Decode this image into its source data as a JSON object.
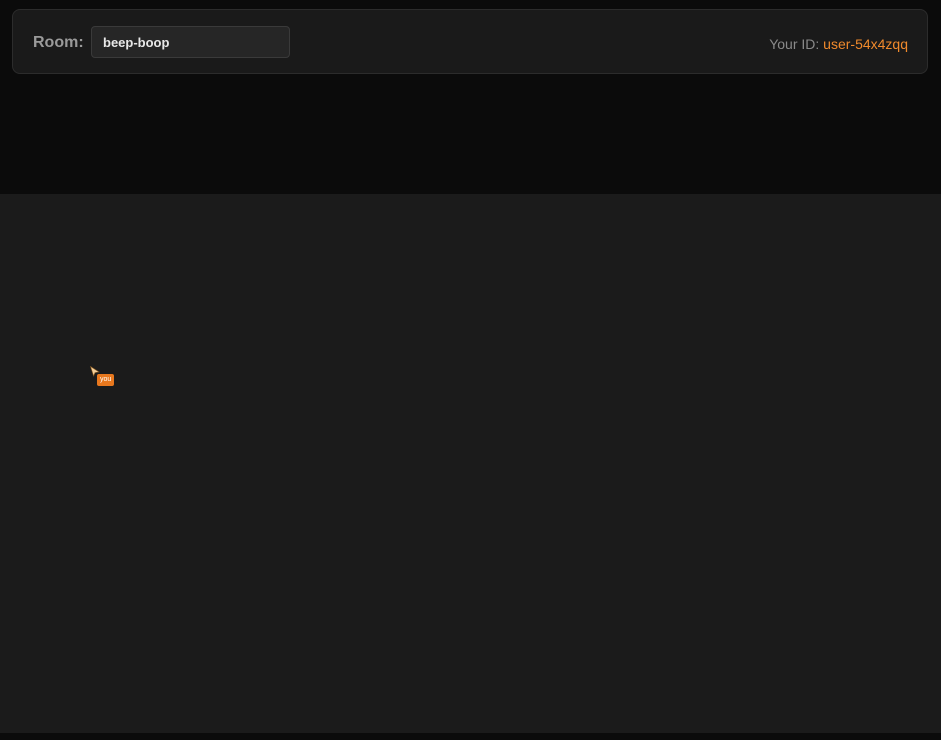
{
  "header": {
    "room_label": "Room:",
    "room_value": "beep-boop",
    "user_id_label": "Your ID:",
    "user_id_value": "user-54x4zqq"
  },
  "cursor": {
    "label": "you",
    "icon": "pointer-arrow-icon"
  },
  "colors": {
    "accent": "#f08a2c",
    "cursor_tag": "#e8781e",
    "header_bg": "#1a1a1a",
    "canvas_bg": "#1b1b1b",
    "page_bg": "#0b0b0b"
  }
}
